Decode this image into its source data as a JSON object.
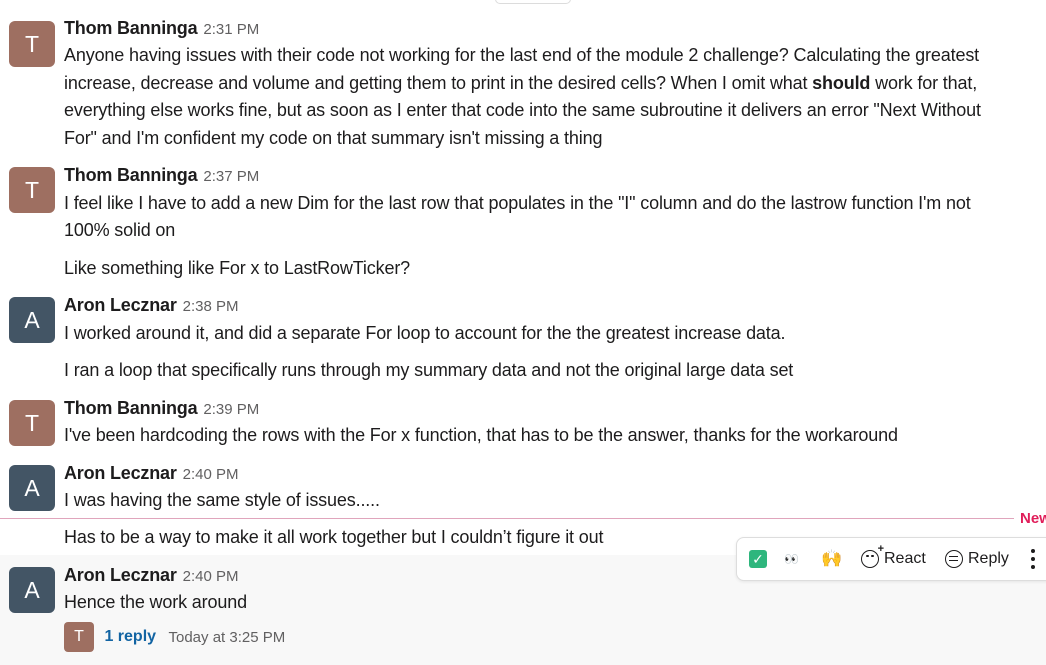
{
  "messages": [
    {
      "avatar_letter": "T",
      "author": "Thom Banninga",
      "time": "2:31 PM",
      "lines": [
        "Anyone having issues with their code not working for the last end of the module 2 challenge? Calculating the greatest",
        "everything else works fine, but as soon as I enter that code into the same subroutine it delivers an error \"Next Without",
        "For\" and I'm confident my code on that summary isn't missing a thing"
      ],
      "line2_pre": "increase, decrease and volume and getting them to print in the desired cells? When I omit what ",
      "line2_bold": "should",
      "line2_post": " work for that,"
    },
    {
      "avatar_letter": "T",
      "author": "Thom Banninga",
      "time": "2:37 PM",
      "lines": [
        "I feel like I have to add a new Dim for the last row that populates in the \"I\" column and do the lastrow function I'm not",
        "100% solid on",
        "Like something like For x to LastRowTicker?"
      ]
    },
    {
      "avatar_letter": "A",
      "author": "Aron Lecznar",
      "time": "2:38 PM",
      "lines": [
        "I worked around it, and did a separate For loop to account for the the greatest increase data.",
        "I ran a loop that specifically runs through my summary data and not the original large data set"
      ]
    },
    {
      "avatar_letter": "T",
      "author": "Thom Banninga",
      "time": "2:39 PM",
      "lines": [
        "I've been hardcoding the rows with the For x function, that has to be the answer, thanks for the workaround"
      ]
    },
    {
      "avatar_letter": "A",
      "author": "Aron Lecznar",
      "time": "2:40 PM",
      "lines": [
        "I was having the same style of issues.....",
        "Has to be a way to make it all work together but I couldn’t figure it out"
      ]
    },
    {
      "avatar_letter": "A",
      "author": "Aron Lecznar",
      "time": "2:40 PM",
      "lines": [
        "Hence the work around"
      ],
      "thread": {
        "avatar_letter": "T",
        "reply_count": "1 reply",
        "last_reply": "Today at 3:25 PM"
      }
    }
  ],
  "new_divider_label": "New",
  "toolbar": {
    "react_label": "React",
    "reply_label": "Reply",
    "checkmark_symbol": "✓",
    "eyes_symbol": "👀",
    "hands_symbol": "🙌"
  },
  "colors": {
    "avatar_t": "#9e6f61",
    "avatar_a": "#435565",
    "new_red": "#e01e5a",
    "link_blue": "#1264a3",
    "check_green": "#2eb67d"
  }
}
